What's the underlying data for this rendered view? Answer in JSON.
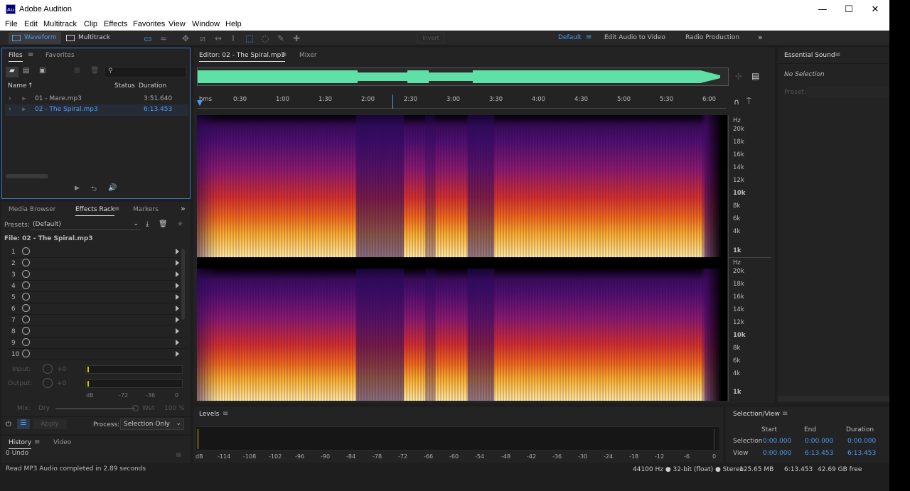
{
  "app": {
    "title": "Adobe Audition",
    "logo": "Au"
  },
  "window_controls": {
    "minimize": "—",
    "maximize": "☐",
    "close": "✕"
  },
  "menu": [
    "File",
    "Edit",
    "Multitrack",
    "Clip",
    "Effects",
    "Favorites",
    "View",
    "Window",
    "Help"
  ],
  "toolbar": {
    "waveform": "Waveform",
    "multitrack": "Multitrack",
    "invert": "Invert",
    "workspaces": [
      "Default",
      "Edit Audio to Video",
      "Radio Production"
    ],
    "more": "»"
  },
  "files_panel": {
    "tabs": [
      "Files",
      "Favorites"
    ],
    "columns": {
      "name": "Name",
      "status": "Status",
      "duration": "Duration"
    },
    "files": [
      {
        "name": "01 - Mare.mp3",
        "duration": "3:51.640"
      },
      {
        "name": "02 - The Spiral.mp3",
        "duration": "6:13.453"
      }
    ]
  },
  "effects_panel": {
    "tabs": [
      "Media Browser",
      "Effects Rack",
      "Markers"
    ],
    "presets_label": "Presets:",
    "presets_value": "(Default)",
    "file_label": "File: 02 - The Spiral.mp3",
    "slots": [
      "1",
      "2",
      "3",
      "4",
      "5",
      "6",
      "7",
      "8",
      "9",
      "10"
    ],
    "input_label": "Input:",
    "input_val": "+0",
    "output_label": "Output:",
    "output_val": "+0",
    "meter_scale": [
      "dB",
      "-72",
      "-36",
      "0"
    ],
    "mix_label": "Mix:",
    "dry": "Dry",
    "wet": "Wet",
    "mix_pct": "100 %",
    "apply": "Apply",
    "process_label": "Process:",
    "process_value": "Selection Only"
  },
  "history_panel": {
    "tabs": [
      "History",
      "Video"
    ],
    "undo": "0 Undo"
  },
  "status": "Read MP3 Audio completed in 2.89 seconds",
  "editor": {
    "tab": "Editor: 02 - The Spiral.mp3",
    "mixer": "Mixer",
    "time_labels": [
      "hms",
      "0:30",
      "1:00",
      "1:30",
      "2:00",
      "2:30",
      "3:00",
      "3:30",
      "4:00",
      "4:30",
      "5:00",
      "5:30",
      "6:00"
    ],
    "freq_labels": [
      "Hz",
      "20k",
      "18k",
      "16k",
      "14k",
      "12k",
      "10k",
      "8k",
      "6k",
      "4k",
      "1k"
    ]
  },
  "essential_sound": {
    "title": "Essential Sound",
    "no_selection": "No Selection",
    "preset": "Preset:"
  },
  "levels": {
    "title": "Levels",
    "scale": [
      "dB",
      "-114",
      "-108",
      "-102",
      "-96",
      "-90",
      "-84",
      "-78",
      "-72",
      "-66",
      "-60",
      "-54",
      "-48",
      "-42",
      "-36",
      "-30",
      "-24",
      "-18",
      "-12",
      "-6",
      "0"
    ]
  },
  "selection_view": {
    "title": "Selection/View",
    "cols": [
      "Start",
      "End",
      "Duration"
    ],
    "rows": [
      {
        "label": "Selection",
        "start": "0:00.000",
        "end": "0:00.000",
        "duration": "0:00.000"
      },
      {
        "label": "View",
        "start": "0:00.000",
        "end": "6:13.453",
        "duration": "6:13.453"
      }
    ]
  },
  "statusbar": {
    "format": "44100 Hz ● 32-bit (float) ● Stereo",
    "size": "125.65 MB",
    "duration": "6:13.453",
    "free": "42.69 GB free"
  },
  "colors": {
    "accent": "#4e9bf5",
    "waveform": "#5fe0a6"
  }
}
